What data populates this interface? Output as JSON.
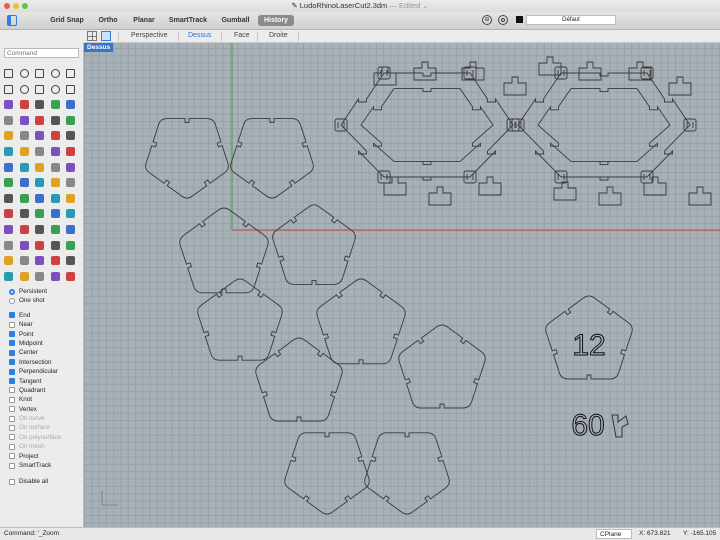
{
  "window": {
    "title": "LudoRhinoLaserCut2.3dm",
    "edited": "— Edited ⌄"
  },
  "toolbar": {
    "toggles": [
      "Grid Snap",
      "Ortho",
      "Planar",
      "SmartTrack",
      "Gumball",
      "History"
    ],
    "active_toggle": "History",
    "layer": "Défaut"
  },
  "viewport_tabs": [
    "Perspective",
    "Dessus",
    "Face",
    "Droite"
  ],
  "active_tab": "Dessus",
  "command_placeholder": "Command",
  "viewport": {
    "label": "Dessus",
    "engraving_count": "12",
    "engraving_total": "60"
  },
  "snap_mode": [
    {
      "label": "Persistent",
      "selected": true
    },
    {
      "label": "One shot",
      "selected": false
    }
  ],
  "osnaps": [
    {
      "label": "End",
      "checked": true,
      "enabled": true
    },
    {
      "label": "Near",
      "checked": false,
      "enabled": true
    },
    {
      "label": "Point",
      "checked": true,
      "enabled": true
    },
    {
      "label": "Midpoint",
      "checked": true,
      "enabled": true
    },
    {
      "label": "Center",
      "checked": true,
      "enabled": true
    },
    {
      "label": "Intersection",
      "checked": true,
      "enabled": true
    },
    {
      "label": "Perpendicular",
      "checked": true,
      "enabled": true
    },
    {
      "label": "Tangent",
      "checked": true,
      "enabled": true
    },
    {
      "label": "Quadrant",
      "checked": false,
      "enabled": true
    },
    {
      "label": "Knot",
      "checked": false,
      "enabled": true
    },
    {
      "label": "Vertex",
      "checked": false,
      "enabled": true
    },
    {
      "label": "On curve",
      "checked": false,
      "enabled": false
    },
    {
      "label": "On surface",
      "checked": false,
      "enabled": false
    },
    {
      "label": "On polysurface",
      "checked": false,
      "enabled": false
    },
    {
      "label": "On mesh",
      "checked": false,
      "enabled": false
    },
    {
      "label": "Project",
      "checked": false,
      "enabled": true
    },
    {
      "label": "SmartTrack",
      "checked": false,
      "enabled": true
    }
  ],
  "disable_all": "Disable all",
  "status": {
    "command": "Command: '_Zoom",
    "cplane": "CPlane",
    "x": "X: 673.821",
    "y": "Y: -165.105"
  },
  "colors": {
    "accent": "#2d7fe0",
    "viewport_bg": "#a8b0b8",
    "x_axis": "#c04848",
    "y_axis": "#4a9a4a"
  }
}
